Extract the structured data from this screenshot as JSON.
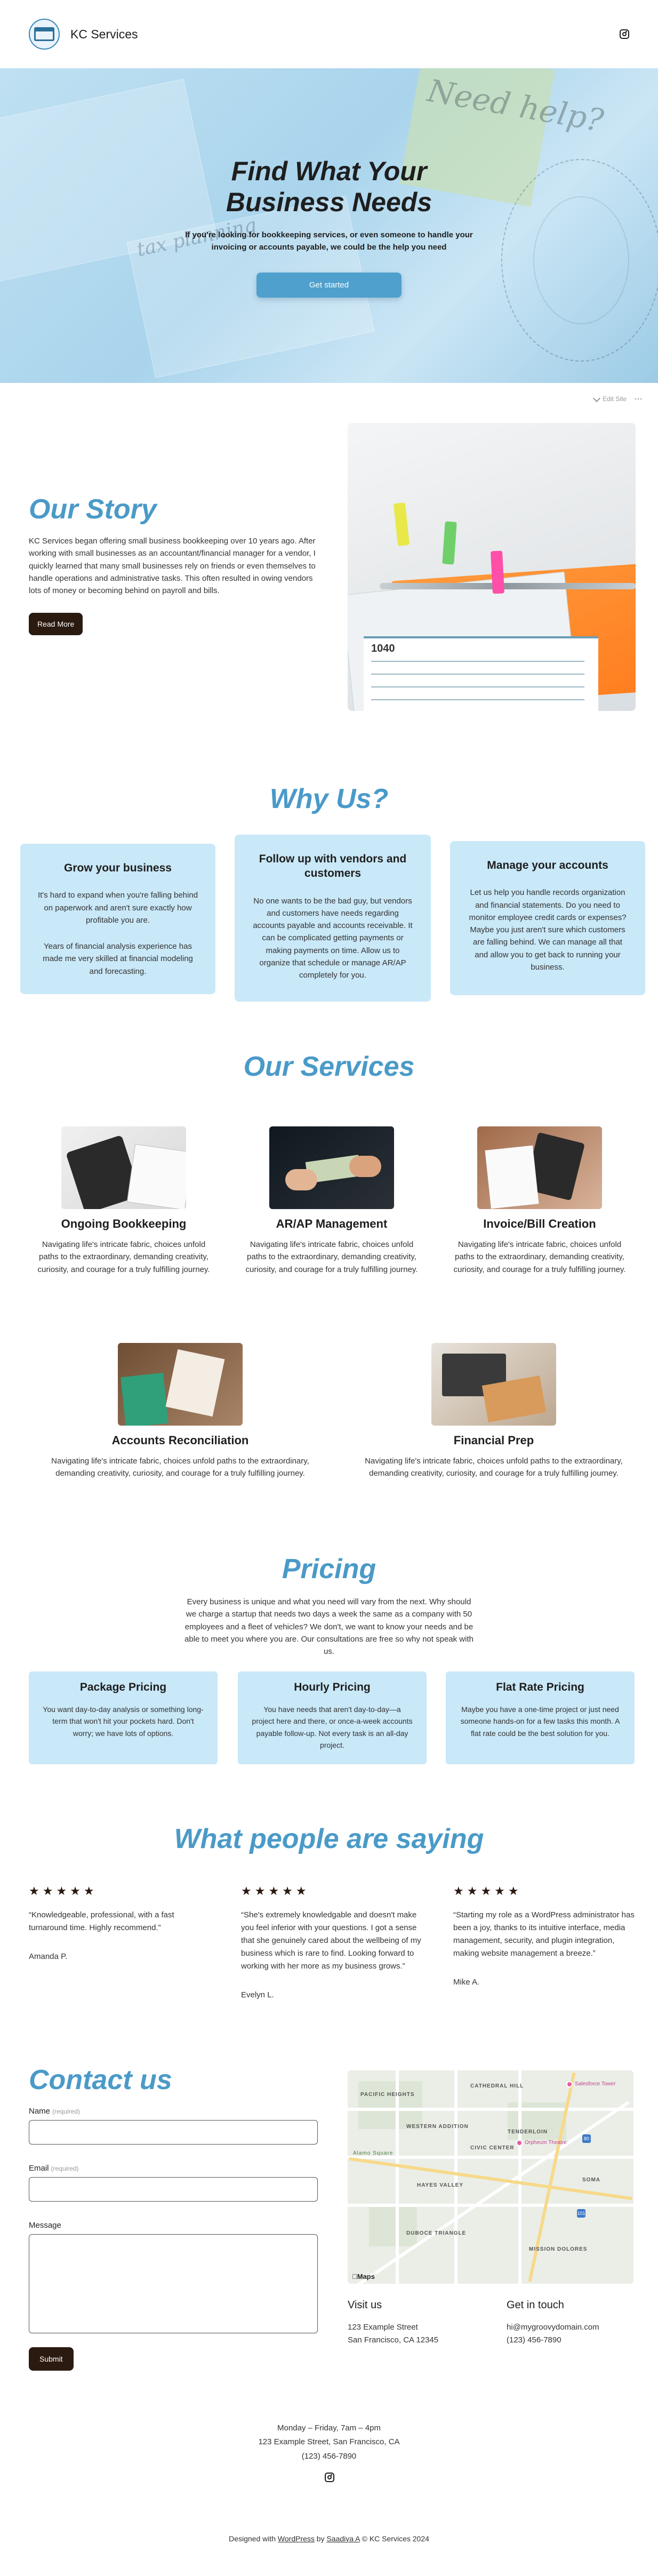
{
  "header": {
    "brand": "KC Services",
    "instagram_icon": "instagram-icon"
  },
  "hero": {
    "title": "Find What Your Business Needs",
    "subtitle": "If you're looking for bookkeeping services, or even someone to handle your invoicing or accounts payable, we could be the help you need",
    "cta": "Get started",
    "note_text": "Need help?",
    "handwriting": "tax planning"
  },
  "admin": {
    "edit_site": "Edit Site",
    "more": "⋯"
  },
  "story": {
    "title": "Our Story",
    "body": "KC Services began offering small business bookkeeping over 10 years ago. After working with small businesses as an accountant/financial manager for a vendor, I quickly learned that many small businesses rely on friends or even themselves to handle operations and administrative tasks. This often resulted in owing vendors lots of money or becoming behind on payroll and bills.",
    "button": "Read More",
    "form_heading": "1040"
  },
  "why": {
    "title": "Why Us?",
    "cards": [
      {
        "title": "Grow your business",
        "body1": "It's hard to expand when you're falling behind on paperwork and aren't sure exactly how profitable you are.",
        "body2": "Years of financial analysis experience has made me very skilled at financial modeling and forecasting."
      },
      {
        "title": "Follow up with vendors and customers",
        "body1": "No one wants to be the bad guy, but vendors and customers have needs regarding accounts payable and accounts receivable. It can be complicated getting payments or making payments on time. Allow us to organize that schedule or manage AR/AP completely for you.",
        "body2": ""
      },
      {
        "title": "Manage your accounts",
        "body1": "Let us help you handle records organization and financial statements. Do you need to monitor employee credit cards or expenses? Maybe you just aren't sure which customers are falling behind. We can manage all that and allow you to get back to running your business.",
        "body2": ""
      }
    ]
  },
  "services": {
    "title": "Our Services",
    "items": [
      {
        "name": "Ongoing Bookkeeping",
        "desc": "Navigating life's intricate fabric, choices unfold paths to the extraordinary, demanding creativity, curiosity, and courage for a truly fulfilling journey."
      },
      {
        "name": "AR/AP Management",
        "desc": "Navigating life's intricate fabric, choices unfold paths to the extraordinary, demanding creativity, curiosity, and courage for a truly fulfilling journey."
      },
      {
        "name": "Invoice/Bill Creation",
        "desc": "Navigating life's intricate fabric, choices unfold paths to the extraordinary, demanding creativity, curiosity, and courage for a truly fulfilling journey."
      },
      {
        "name": "Accounts Reconciliation",
        "desc": "Navigating life's intricate fabric, choices unfold paths to the extraordinary, demanding creativity, curiosity, and courage for a truly fulfilling journey."
      },
      {
        "name": "Financial Prep",
        "desc": "Navigating life's intricate fabric, choices unfold paths to the extraordinary, demanding creativity, curiosity, and courage for a truly fulfilling journey."
      }
    ]
  },
  "pricing": {
    "title": "Pricing",
    "intro": "Every business is unique and what you need will vary from the next. Why should we charge a startup that needs two days a week the same as a company with 50 employees and a fleet of vehicles? We don't, we want to know your needs and be able to meet you where you are. Our consultations are free so why not speak with us.",
    "plans": [
      {
        "name": "Package Pricing",
        "desc": "You want day-to-day analysis or something long-term that won't hit your pockets hard. Don't worry; we have lots of options."
      },
      {
        "name": "Hourly Pricing",
        "desc": "You have needs that aren't day-to-day—a project here and there, or once-a-week accounts payable follow-up. Not every task is an all-day project."
      },
      {
        "name": "Flat Rate Pricing",
        "desc": "Maybe you have a one-time project or just need someone hands-on for a few tasks this month. A flat rate could be the best solution for you."
      }
    ]
  },
  "testimonials": {
    "title": "What people are saying",
    "stars": "★★★★★",
    "items": [
      {
        "quote": "“Knowledgeable, professional, with a fast turnaround time. Highly recommend.”",
        "author": "Amanda P."
      },
      {
        "quote": "“She's extremely knowledgable and doesn't make you feel inferior with your questions. I got a sense that she genuinely cared about the wellbeing of my business which is rare to find. Looking forward to working with her more as my business grows.”",
        "author": "Evelyn L."
      },
      {
        "quote": "“Starting my role as a WordPress administrator has been a joy, thanks to its intuitive interface, media management, security, and plugin integration, making website management a breeze.”",
        "author": "Mike A."
      }
    ]
  },
  "contact": {
    "title": "Contact us",
    "name_label": "Name",
    "email_label": "Email",
    "required": "(required)",
    "message_label": "Message",
    "submit": "Submit",
    "map_labels": [
      "PACIFIC HEIGHTS",
      "CATHEDRAL HILL",
      "TENDERLOIN",
      "WESTERN ADDITION",
      "CIVIC CENTER",
      "HAYES VALLEY",
      "DUBOCE TRIANGLE",
      "SOMA",
      "MISSION DOLORES",
      "Alamo Square"
    ],
    "map_pin_labels": [
      "Salesforce Tower",
      "Orpheum Theatre"
    ],
    "map_brand": "Maps",
    "visit_title": "Visit us",
    "visit_line1": "123 Example Street",
    "visit_line2": "San Francisco, CA 12345",
    "touch_title": "Get in touch",
    "touch_email": "hi@mygroovydomain.com",
    "touch_phone": "(123) 456-7890"
  },
  "footer": {
    "hours": "Monday – Friday, 7am – 4pm",
    "address": "123 Example Street, San Francisco, CA",
    "phone": "(123) 456-7890",
    "credits_prefix": "Designed with",
    "wp_link": "WordPress",
    "credits_by": "by",
    "author_link": "Saadiya A",
    "copyright": "© KC Services 2024"
  }
}
